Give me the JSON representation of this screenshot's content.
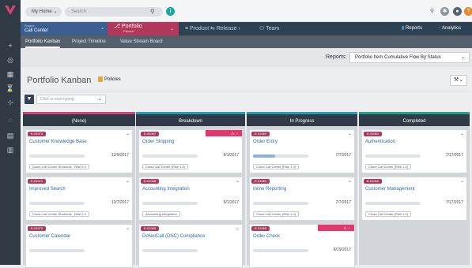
{
  "top": {
    "my_home": "My Home ⌄",
    "search_placeholder": "Search"
  },
  "nav": {
    "project_small": "Project",
    "project_name": "Call Center",
    "portfolio": "Portfolio",
    "portfolio_sub": "Planner",
    "product": "Product",
    "release": "Release",
    "team": "Team",
    "reports": "Reports",
    "analytics": "Analytics"
  },
  "subnav": {
    "items": [
      "Portfolio Kanban",
      "Project Timeline",
      "Value Stream Board"
    ]
  },
  "reports_bar": {
    "label": "Reports:",
    "selected": "Portfolio Item Cumulative Flow By Status"
  },
  "panel": {
    "title": "Portfolio Kanban",
    "policies": "Policies",
    "filter_placeholder": "Click or start typing"
  },
  "columns": [
    {
      "name": "(None)",
      "color": "#d1447a",
      "cards": [
        {
          "id": "E-01070",
          "title": "Customer Knowledge Base",
          "date": "12/9/2017",
          "tag": "Cloud Call Center Shortcuts - Rise 2.0",
          "progress": 0
        },
        {
          "id": "E-01071",
          "title": "Improved Search",
          "date": "12/7/2017",
          "tag": "Cloud Call Center Shortcuts - Rise 2.0",
          "progress": 0
        },
        {
          "id": "E-01072",
          "title": "Customer Calendar",
          "date": "",
          "tag": "",
          "progress": 0
        }
      ]
    },
    {
      "name": "Breakdown",
      "color": "#2a9bb4",
      "cards": [
        {
          "id": "E-01067",
          "title": "Order Shipping",
          "date": "9/1/2017",
          "tag": "Cloud Call Center (Rise 1.0)",
          "progress": 0,
          "alert": true
        },
        {
          "id": "E-01068",
          "title": "Accounting Integration",
          "date": "9/1/2017",
          "tag": "Accounting Integration",
          "progress": 0
        },
        {
          "id": "E-01069",
          "title": "DoNotCall (DNC) Compliance",
          "date": "",
          "tag": "",
          "progress": 0
        }
      ]
    },
    {
      "name": "In Progress",
      "color": "#2a9bb4",
      "cards": [
        {
          "id": "E-01063",
          "title": "Order Entry",
          "date": "7/7/2017",
          "tag": "Cloud Call Center (Rise 1.0)",
          "progress": 0.4
        },
        {
          "id": "E-01064",
          "title": "Inline Reporting",
          "date": "7/7/2017",
          "tag": "Cloud Call Center (Rise 1.0)",
          "progress": 0
        },
        {
          "id": "E-01065",
          "title": "Order Check",
          "date": "8/19/2017",
          "tag": "",
          "progress": 0,
          "alert": true
        }
      ]
    },
    {
      "name": "Completed",
      "color": "#27a08e",
      "cards": [
        {
          "id": "E-01061",
          "title": "Authentication",
          "date": "7/17/2017",
          "tag": "Cloud Call Center (Rise 1.0)",
          "progress": 0
        },
        {
          "id": "E-01062",
          "title": "Customer Management",
          "date": "7/17/2017",
          "tag": "Cloud Call Center (Rise 1.0)",
          "progress": 0
        }
      ]
    }
  ]
}
